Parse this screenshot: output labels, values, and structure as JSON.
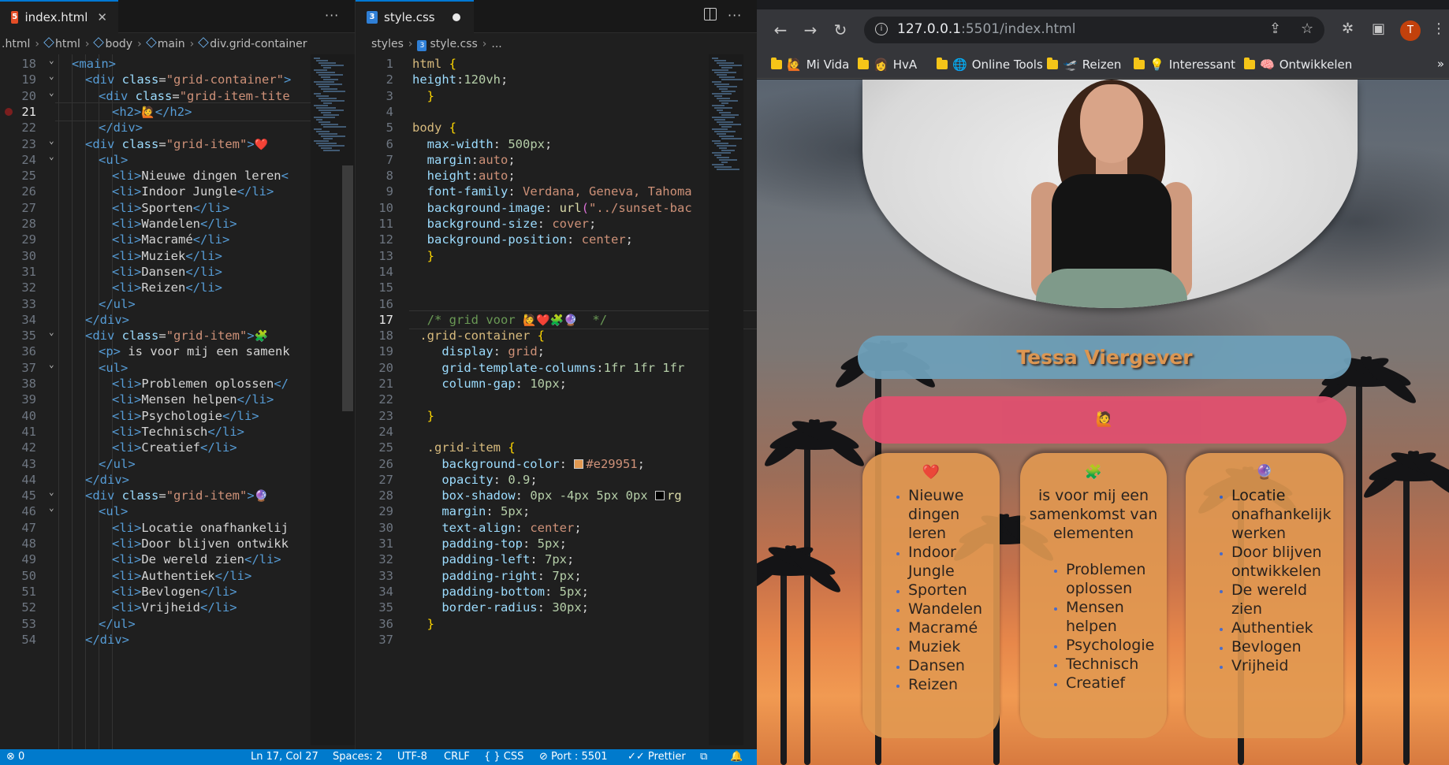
{
  "left_editor": {
    "tab_label": "index.html",
    "tab_close": "✕",
    "more": "···",
    "breadcrumbs": [
      ".html",
      "html",
      "body",
      "main",
      "div.grid-container"
    ],
    "lines": [
      {
        "n": "18",
        "fold": true,
        "html": "<span class=\"t-tag\">&lt;main&gt;</span>",
        "indent": 1
      },
      {
        "n": "19",
        "fold": true,
        "html": "<span class=\"t-tag\">&lt;div</span> <span class=\"t-attr\">class</span><span class=\"t-plain\">=</span><span class=\"t-str\">\"grid-container\"</span><span class=\"t-tag\">&gt;</span>",
        "indent": 2
      },
      {
        "n": "20",
        "fold": true,
        "html": "<span class=\"t-tag\">&lt;div</span> <span class=\"t-attr\">class</span><span class=\"t-plain\">=</span><span class=\"t-str\">\"grid-item-tite</span>",
        "indent": 3
      },
      {
        "n": "21",
        "fold": false,
        "html": "<span class=\"t-tag\">&lt;h2&gt;</span><span class=\"emoji\">🙋</span><span class=\"t-tag\">&lt;/h2&gt;</span>",
        "indent": 4,
        "current": true
      },
      {
        "n": "22",
        "fold": false,
        "html": "<span class=\"t-tag\">&lt;/div&gt;</span>",
        "indent": 3
      },
      {
        "n": "23",
        "fold": true,
        "html": "<span class=\"t-tag\">&lt;div</span> <span class=\"t-attr\">class</span><span class=\"t-plain\">=</span><span class=\"t-str\">\"grid-item\"</span><span class=\"t-tag\">&gt;</span><span class=\"emoji\">❤️</span>",
        "indent": 2
      },
      {
        "n": "24",
        "fold": true,
        "html": "<span class=\"t-tag\">&lt;ul&gt;</span>",
        "indent": 3
      },
      {
        "n": "25",
        "fold": false,
        "html": "<span class=\"t-tag\">&lt;li&gt;</span><span class=\"t-txt\">Nieuwe dingen leren</span><span class=\"t-tag\">&lt;</span>",
        "indent": 4
      },
      {
        "n": "26",
        "fold": false,
        "html": "<span class=\"t-tag\">&lt;li&gt;</span><span class=\"t-txt\">Indoor Jungle</span><span class=\"t-tag\">&lt;/li&gt;</span>",
        "indent": 4
      },
      {
        "n": "27",
        "fold": false,
        "html": "<span class=\"t-tag\">&lt;li&gt;</span><span class=\"t-txt\">Sporten</span><span class=\"t-tag\">&lt;/li&gt;</span>",
        "indent": 4
      },
      {
        "n": "28",
        "fold": false,
        "html": "<span class=\"t-tag\">&lt;li&gt;</span><span class=\"t-txt\">Wandelen</span><span class=\"t-tag\">&lt;/li&gt;</span>",
        "indent": 4
      },
      {
        "n": "29",
        "fold": false,
        "html": "<span class=\"t-tag\">&lt;li&gt;</span><span class=\"t-txt\">Macramé</span><span class=\"t-tag\">&lt;/li&gt;</span>",
        "indent": 4
      },
      {
        "n": "30",
        "fold": false,
        "html": "<span class=\"t-tag\">&lt;li&gt;</span><span class=\"t-txt\">Muziek</span><span class=\"t-tag\">&lt;/li&gt;</span>",
        "indent": 4
      },
      {
        "n": "31",
        "fold": false,
        "html": "<span class=\"t-tag\">&lt;li&gt;</span><span class=\"t-txt\">Dansen</span><span class=\"t-tag\">&lt;/li&gt;</span>",
        "indent": 4
      },
      {
        "n": "32",
        "fold": false,
        "html": "<span class=\"t-tag\">&lt;li&gt;</span><span class=\"t-txt\">Reizen</span><span class=\"t-tag\">&lt;/li&gt;</span>",
        "indent": 4
      },
      {
        "n": "33",
        "fold": false,
        "html": "<span class=\"t-tag\">&lt;/ul&gt;</span>",
        "indent": 3
      },
      {
        "n": "34",
        "fold": false,
        "html": "<span class=\"t-tag\">&lt;/div&gt;</span>",
        "indent": 2
      },
      {
        "n": "35",
        "fold": true,
        "html": "<span class=\"t-tag\">&lt;div</span> <span class=\"t-attr\">class</span><span class=\"t-plain\">=</span><span class=\"t-str\">\"grid-item\"</span><span class=\"t-tag\">&gt;</span><span class=\"emoji\">🧩</span>",
        "indent": 2
      },
      {
        "n": "36",
        "fold": false,
        "html": "<span class=\"t-tag\">&lt;p&gt;</span><span class=\"t-txt\"> is voor mij een samenk</span>",
        "indent": 3
      },
      {
        "n": "37",
        "fold": true,
        "html": "<span class=\"t-tag\">&lt;ul&gt;</span>",
        "indent": 3
      },
      {
        "n": "38",
        "fold": false,
        "html": "<span class=\"t-tag\">&lt;li&gt;</span><span class=\"t-txt\">Problemen oplossen</span><span class=\"t-tag\">&lt;/</span>",
        "indent": 4
      },
      {
        "n": "39",
        "fold": false,
        "html": "<span class=\"t-tag\">&lt;li&gt;</span><span class=\"t-txt\">Mensen helpen</span><span class=\"t-tag\">&lt;/li&gt;</span>",
        "indent": 4
      },
      {
        "n": "40",
        "fold": false,
        "html": "<span class=\"t-tag\">&lt;li&gt;</span><span class=\"t-txt\">Psychologie</span><span class=\"t-tag\">&lt;/li&gt;</span>",
        "indent": 4
      },
      {
        "n": "41",
        "fold": false,
        "html": "<span class=\"t-tag\">&lt;li&gt;</span><span class=\"t-txt\">Technisch</span><span class=\"t-tag\">&lt;/li&gt;</span>",
        "indent": 4
      },
      {
        "n": "42",
        "fold": false,
        "html": "<span class=\"t-tag\">&lt;li&gt;</span><span class=\"t-txt\">Creatief</span><span class=\"t-tag\">&lt;/li&gt;</span>",
        "indent": 4
      },
      {
        "n": "43",
        "fold": false,
        "html": "<span class=\"t-tag\">&lt;/ul&gt;</span>",
        "indent": 3
      },
      {
        "n": "44",
        "fold": false,
        "html": "<span class=\"t-tag\">&lt;/div&gt;</span>",
        "indent": 2
      },
      {
        "n": "45",
        "fold": true,
        "html": "<span class=\"t-tag\">&lt;div</span> <span class=\"t-attr\">class</span><span class=\"t-plain\">=</span><span class=\"t-str\">\"grid-item\"</span><span class=\"t-tag\">&gt;</span><span class=\"emoji\">🔮</span>",
        "indent": 2
      },
      {
        "n": "46",
        "fold": true,
        "html": "<span class=\"t-tag\">&lt;ul&gt;</span>",
        "indent": 3
      },
      {
        "n": "47",
        "fold": false,
        "html": "<span class=\"t-tag\">&lt;li&gt;</span><span class=\"t-txt\">Locatie onafhankelij</span>",
        "indent": 4
      },
      {
        "n": "48",
        "fold": false,
        "html": "<span class=\"t-tag\">&lt;li&gt;</span><span class=\"t-txt\">Door blijven ontwikk</span>",
        "indent": 4
      },
      {
        "n": "49",
        "fold": false,
        "html": "<span class=\"t-tag\">&lt;li&gt;</span><span class=\"t-txt\">De wereld zien</span><span class=\"t-tag\">&lt;/li&gt;</span>",
        "indent": 4
      },
      {
        "n": "50",
        "fold": false,
        "html": "<span class=\"t-tag\">&lt;li&gt;</span><span class=\"t-txt\">Authentiek</span><span class=\"t-tag\">&lt;/li&gt;</span>",
        "indent": 4
      },
      {
        "n": "51",
        "fold": false,
        "html": "<span class=\"t-tag\">&lt;li&gt;</span><span class=\"t-txt\">Bevlogen</span><span class=\"t-tag\">&lt;/li&gt;</span>",
        "indent": 4
      },
      {
        "n": "52",
        "fold": false,
        "html": "<span class=\"t-tag\">&lt;li&gt;</span><span class=\"t-txt\">Vrijheid</span><span class=\"t-tag\">&lt;/li&gt;</span>",
        "indent": 4
      },
      {
        "n": "53",
        "fold": false,
        "html": "<span class=\"t-tag\">&lt;/ul&gt;</span>",
        "indent": 3
      },
      {
        "n": "54",
        "fold": false,
        "html": "<span class=\"t-tag\">&lt;/div&gt;</span>",
        "indent": 2
      }
    ]
  },
  "mid_editor": {
    "tab_label": "style.css",
    "more": "···",
    "breadcrumbs": [
      "styles",
      "style.css",
      "..."
    ],
    "lines": [
      {
        "n": "1",
        "html": "<span class=\"t-sel\">html</span> <span class=\"t-br\">{</span>"
      },
      {
        "n": "2",
        "html": "<span class=\"t-prop\">height</span><span class=\"t-plain\">:</span><span class=\"t-num\">120vh</span><span class=\"t-plain\">;</span>"
      },
      {
        "n": "3",
        "html": "  <span class=\"t-br\">}</span>"
      },
      {
        "n": "4",
        "html": ""
      },
      {
        "n": "5",
        "html": "<span class=\"t-sel\">body</span> <span class=\"t-br\">{</span>"
      },
      {
        "n": "6",
        "html": "  <span class=\"t-prop\">max-width</span><span class=\"t-plain\">: </span><span class=\"t-num\">500px</span><span class=\"t-plain\">;</span>"
      },
      {
        "n": "7",
        "html": "  <span class=\"t-prop\">margin</span><span class=\"t-plain\">:</span><span class=\"t-val\">auto</span><span class=\"t-plain\">;</span>"
      },
      {
        "n": "8",
        "html": "  <span class=\"t-prop\">height</span><span class=\"t-plain\">:</span><span class=\"t-val\">auto</span><span class=\"t-plain\">;</span>"
      },
      {
        "n": "9",
        "html": "  <span class=\"t-prop\">font-family</span><span class=\"t-plain\">: </span><span class=\"t-val\">Verdana, Geneva, Tahoma</span>"
      },
      {
        "n": "10",
        "html": "  <span class=\"t-prop\">background-image</span><span class=\"t-plain\">: </span><span class=\"t-func\">url</span><span class=\"t-br2\">(</span><span class=\"t-str\">\"../sunset-bac</span>"
      },
      {
        "n": "11",
        "html": "  <span class=\"t-prop\">background-size</span><span class=\"t-plain\">: </span><span class=\"t-val\">cover</span><span class=\"t-plain\">;</span>"
      },
      {
        "n": "12",
        "html": "  <span class=\"t-prop\">background-position</span><span class=\"t-plain\">: </span><span class=\"t-val\">center</span><span class=\"t-plain\">;</span>"
      },
      {
        "n": "13",
        "html": "  <span class=\"t-br\">}</span>"
      },
      {
        "n": "14",
        "html": ""
      },
      {
        "n": "15",
        "html": ""
      },
      {
        "n": "16",
        "html": ""
      },
      {
        "n": "17",
        "html": "  <span class=\"t-com\">/* grid voor </span><span class=\"emoji\">🙋❤️🧩🔮</span><span class=\"t-com\">  */</span>",
        "current": true
      },
      {
        "n": "18",
        "html": " <span class=\"t-sel\">.grid-container</span> <span class=\"t-br\">{</span>"
      },
      {
        "n": "19",
        "html": "    <span class=\"t-prop\">display</span><span class=\"t-plain\">: </span><span class=\"t-val\">grid</span><span class=\"t-plain\">;</span>"
      },
      {
        "n": "20",
        "html": "    <span class=\"t-prop\">grid-template-columns</span><span class=\"t-plain\">:</span><span class=\"t-num\">1fr 1fr 1fr</span>"
      },
      {
        "n": "21",
        "html": "    <span class=\"t-prop\">column-gap</span><span class=\"t-plain\">: </span><span class=\"t-num\">10px</span><span class=\"t-plain\">;</span>"
      },
      {
        "n": "22",
        "html": ""
      },
      {
        "n": "23",
        "html": "  <span class=\"t-br\">}</span>"
      },
      {
        "n": "24",
        "html": ""
      },
      {
        "n": "25",
        "html": "  <span class=\"t-sel\">.grid-item</span> <span class=\"t-br\">{</span>"
      },
      {
        "n": "26",
        "html": "    <span class=\"t-prop\">background-color</span><span class=\"t-plain\">: </span><span class=\"swatch\" style=\"background:#e29951\"></span><span class=\"t-val\">#e29951</span><span class=\"t-plain\">;</span>"
      },
      {
        "n": "27",
        "html": "    <span class=\"t-prop\">opacity</span><span class=\"t-plain\">: </span><span class=\"t-num\">0.9</span><span class=\"t-plain\">;</span>"
      },
      {
        "n": "28",
        "html": "    <span class=\"t-prop\">box-shadow</span><span class=\"t-plain\">: </span><span class=\"t-num\">0px -4px 5px 0px</span> <span class=\"swatch\" style=\"background:#000\"></span><span class=\"t-func\">rg</span>"
      },
      {
        "n": "29",
        "html": "    <span class=\"t-prop\">margin</span><span class=\"t-plain\">: </span><span class=\"t-num\">5px</span><span class=\"t-plain\">;</span>"
      },
      {
        "n": "30",
        "html": "    <span class=\"t-prop\">text-align</span><span class=\"t-plain\">: </span><span class=\"t-val\">center</span><span class=\"t-plain\">;</span>"
      },
      {
        "n": "31",
        "html": "    <span class=\"t-prop\">padding-top</span><span class=\"t-plain\">: </span><span class=\"t-num\">5px</span><span class=\"t-plain\">;</span>"
      },
      {
        "n": "32",
        "html": "    <span class=\"t-prop\">padding-left</span><span class=\"t-plain\">: </span><span class=\"t-num\">7px</span><span class=\"t-plain\">;</span>"
      },
      {
        "n": "33",
        "html": "    <span class=\"t-prop\">padding-right</span><span class=\"t-plain\">: </span><span class=\"t-num\">7px</span><span class=\"t-plain\">;</span>"
      },
      {
        "n": "34",
        "html": "    <span class=\"t-prop\">padding-bottom</span><span class=\"t-plain\">: </span><span class=\"t-num\">5px</span><span class=\"t-plain\">;</span>"
      },
      {
        "n": "35",
        "html": "    <span class=\"t-prop\">border-radius</span><span class=\"t-plain\">: </span><span class=\"t-num\">30px</span><span class=\"t-plain\">;</span>"
      },
      {
        "n": "36",
        "html": "  <span class=\"t-br\">}</span>"
      },
      {
        "n": "37",
        "html": ""
      }
    ]
  },
  "status_bar": {
    "errors": "⊗ 0",
    "position": "Ln 17, Col 27",
    "spaces": "Spaces: 2",
    "encoding": "UTF-8",
    "eol": "CRLF",
    "language": "{ } CSS",
    "port": "⊘ Port : 5501",
    "prettier": "✓✓ Prettier"
  },
  "browser": {
    "url_host": "127.0.0.1",
    "url_rest": ":5501/index.html",
    "avatar_letter": "T",
    "bookmarks": [
      {
        "emoji": "🙋",
        "label": "Mi Vida"
      },
      {
        "emoji": "👩",
        "label": "HvA"
      },
      {
        "emoji": "🌐",
        "label": "Online Tools"
      },
      {
        "emoji": "🛫",
        "label": "Reizen"
      },
      {
        "emoji": "💡",
        "label": "Interessant"
      },
      {
        "emoji": "🧠",
        "label": "Ontwikkelen"
      }
    ],
    "bookmarks_more": "»",
    "page": {
      "name": "Tessa Viergever",
      "title_emoji": "🙋",
      "cards": [
        {
          "icon": "❤️",
          "text": "",
          "items": [
            "Nieuwe dingen leren",
            "Indoor Jungle",
            "Sporten",
            "Wandelen",
            "Macramé",
            "Muziek",
            "Dansen",
            "Reizen"
          ]
        },
        {
          "icon": "🧩",
          "text": "is voor mij een samenkomst van elementen",
          "items": [
            "Problemen oplossen",
            "Mensen helpen",
            "Psychologie",
            "Technisch",
            "Creatief"
          ]
        },
        {
          "icon": "🔮",
          "text": "",
          "items": [
            "Locatie onafhankelijk werken",
            "Door blijven ontwikkelen",
            "De wereld zien",
            "Authentiek",
            "Bevlogen",
            "Vrijheid"
          ]
        }
      ]
    }
  }
}
